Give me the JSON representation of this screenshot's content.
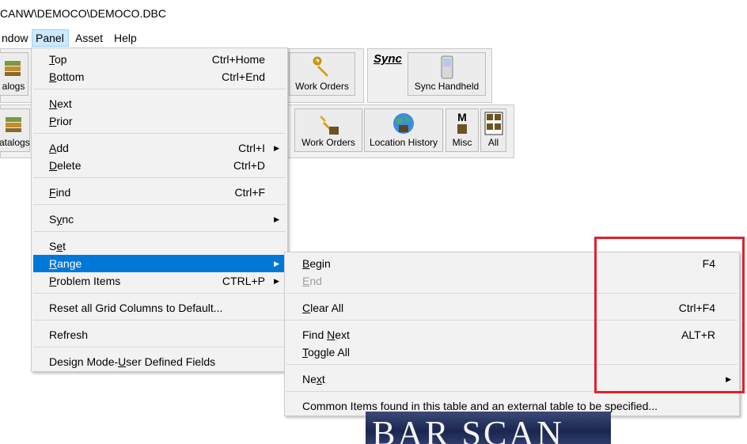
{
  "window": {
    "title": "CANW\\DEMOCO\\DEMOCO.DBC"
  },
  "menubar": {
    "items": [
      "ndow",
      "Panel",
      "Asset",
      "Help"
    ]
  },
  "toolbar_top": {
    "catalogs": "alogs",
    "work_orders": "Work Orders",
    "sync_header": "Sync",
    "sync_handheld": "Sync Handheld"
  },
  "toolbar_bottom": {
    "catalogs": "atalogs",
    "work_orders": "Work Orders",
    "location_history": "Location History",
    "misc": "Misc",
    "all": "All",
    "misc_glyph": "M"
  },
  "panel_menu": {
    "top": {
      "label": "Top",
      "shortcut": "Ctrl+Home"
    },
    "bottom": {
      "label": "Bottom",
      "shortcut": "Ctrl+End"
    },
    "next": {
      "label": "Next"
    },
    "prior": {
      "label": "Prior"
    },
    "add": {
      "label": "Add",
      "shortcut": "Ctrl+I"
    },
    "delete": {
      "label": "Delete",
      "shortcut": "Ctrl+D"
    },
    "find": {
      "label": "Find",
      "shortcut": "Ctrl+F"
    },
    "sync": {
      "label": "Sync"
    },
    "set": {
      "label": "Set"
    },
    "range": {
      "label": "Range"
    },
    "problem_items": {
      "label": "Problem Items",
      "shortcut": "CTRL+P"
    },
    "reset_grid": {
      "label": "Reset all Grid Columns to Default..."
    },
    "refresh": {
      "label": "Refresh"
    },
    "design_mode": {
      "label": "Design Mode-User Defined Fields"
    }
  },
  "range_menu": {
    "begin": {
      "label": "Begin",
      "shortcut": "F4"
    },
    "end": {
      "label": "End"
    },
    "clear_all": {
      "label": "Clear All",
      "shortcut": "Ctrl+F4"
    },
    "find_next": {
      "label": "Find Next",
      "shortcut": "ALT+R"
    },
    "toggle_all": {
      "label": "Toggle All"
    },
    "next": {
      "label": "Next"
    },
    "common_items": {
      "label": "Common Items found in this table and an external table to be specified..."
    }
  },
  "logo": {
    "text": "BAR SCAN"
  },
  "colors": {
    "highlight": "#0078d7",
    "menu_bg": "#f2f2f2",
    "annotation": "#e3202b"
  }
}
